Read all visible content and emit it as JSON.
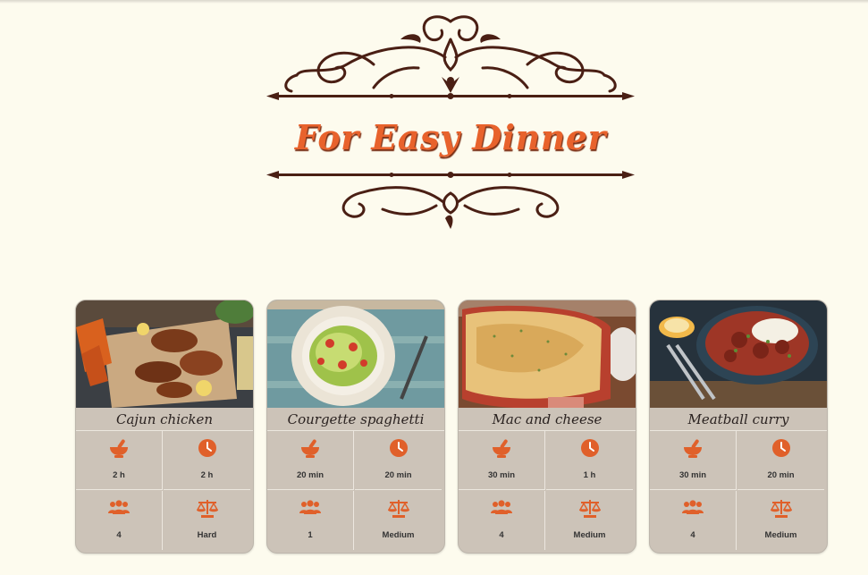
{
  "page": {
    "title": "For Easy Dinner"
  },
  "colors": {
    "accent": "#e8622c",
    "background": "#fdfbee",
    "card": "#ccc3b8"
  },
  "icons": {
    "prep": "mortar-pestle-icon",
    "cook": "clock-icon",
    "serves": "people-icon",
    "difficulty": "scale-icon"
  },
  "recipes": [
    {
      "name": "Cajun chicken",
      "prep": "2 h",
      "cook": "2 h",
      "serves": "4",
      "difficulty": "Hard"
    },
    {
      "name": "Courgette spaghetti",
      "prep": "20 min",
      "cook": "20 min",
      "serves": "1",
      "difficulty": "Medium"
    },
    {
      "name": "Mac and cheese",
      "prep": "30 min",
      "cook": "1 h",
      "serves": "4",
      "difficulty": "Medium"
    },
    {
      "name": "Meatball curry",
      "prep": "30 min",
      "cook": "20 min",
      "serves": "4",
      "difficulty": "Medium"
    }
  ]
}
